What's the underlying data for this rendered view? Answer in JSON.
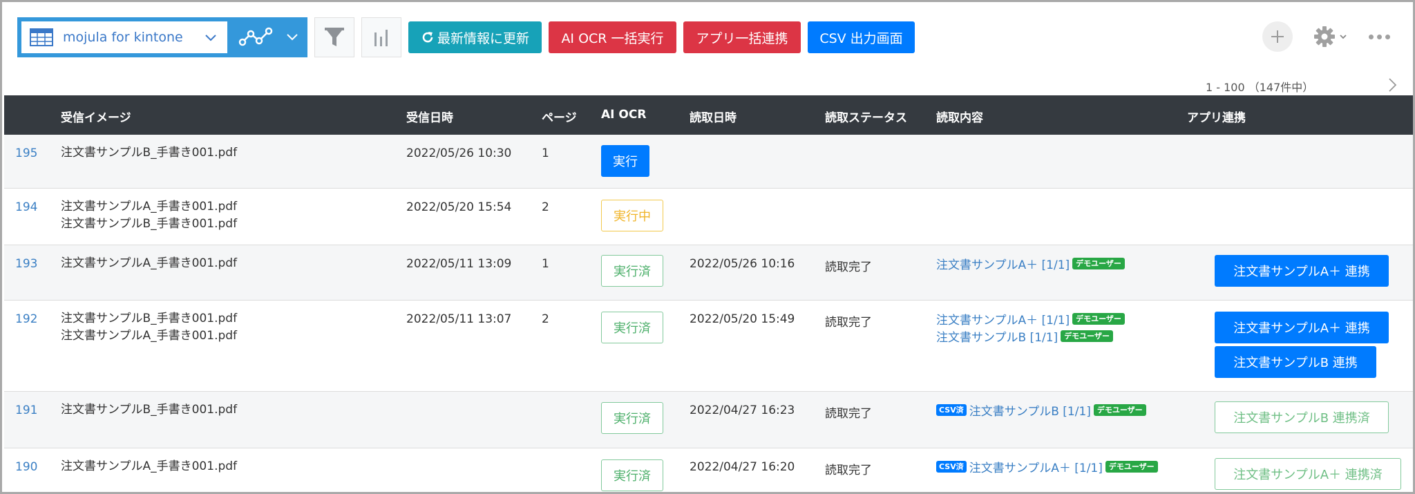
{
  "toolbar": {
    "view_name": "mojula for kintone",
    "refresh_label": "最新情報に更新",
    "ai_ocr_bulk_label": "AI OCR 一括実行",
    "app_bulk_link_label": "アプリ一括連携",
    "csv_export_label": "CSV 出力画面"
  },
  "pager": {
    "text": "1 - 100 （147件中）"
  },
  "columns": {
    "image": "受信イメージ",
    "received": "受信日時",
    "pages": "ページ",
    "ai_ocr": "AI OCR",
    "read_at": "読取日時",
    "status": "読取ステータス",
    "content": "読取内容",
    "app_link": "アプリ連携"
  },
  "badges": {
    "demo": "デモユーザー",
    "csv": "CSV済"
  },
  "rows": [
    {
      "id": "195",
      "files": [
        "注文書サンプルB_手書き001.pdf"
      ],
      "received": "2022/05/26 10:30",
      "pages": "1",
      "ocr": "実行",
      "read_at": "",
      "status": "",
      "contents": [],
      "links": []
    },
    {
      "id": "194",
      "files": [
        "注文書サンプルA_手書き001.pdf",
        "注文書サンプルB_手書き001.pdf"
      ],
      "received": "2022/05/20 15:54",
      "pages": "2",
      "ocr": "実行中",
      "read_at": "",
      "status": "",
      "contents": [],
      "links": []
    },
    {
      "id": "193",
      "files": [
        "注文書サンプルA_手書き001.pdf"
      ],
      "received": "2022/05/11 13:09",
      "pages": "1",
      "ocr": "実行済",
      "read_at": "2022/05/26 10:16",
      "status": "読取完了",
      "contents": [
        "注文書サンプルA＋ [1/1]"
      ],
      "links": [
        "注文書サンプルA＋ 連携"
      ]
    },
    {
      "id": "192",
      "files": [
        "注文書サンプルB_手書き001.pdf",
        "注文書サンプルA_手書き001.pdf"
      ],
      "received": "2022/05/11 13:07",
      "pages": "2",
      "ocr": "実行済",
      "read_at": "2022/05/20 15:49",
      "status": "読取完了",
      "contents": [
        "注文書サンプルA＋ [1/1]",
        "注文書サンプルB [1/1]"
      ],
      "links": [
        "注文書サンプルA＋ 連携",
        "注文書サンプルB 連携"
      ]
    },
    {
      "id": "191",
      "files": [
        "注文書サンプルB_手書き001.pdf"
      ],
      "received": "",
      "pages": "",
      "ocr": "実行済",
      "read_at": "2022/04/27 16:23",
      "status": "読取完了",
      "contents": [
        "注文書サンプルB [1/1]"
      ],
      "links": [
        "注文書サンプルB 連携済"
      ]
    },
    {
      "id": "190",
      "files": [
        "注文書サンプルA_手書き001.pdf"
      ],
      "received": "",
      "pages": "",
      "ocr": "実行済",
      "read_at": "2022/04/27 16:20",
      "status": "読取完了",
      "contents": [
        "注文書サンプルA＋ [1/1]"
      ],
      "links": [
        "注文書サンプルA＋ 連携済"
      ]
    }
  ]
}
